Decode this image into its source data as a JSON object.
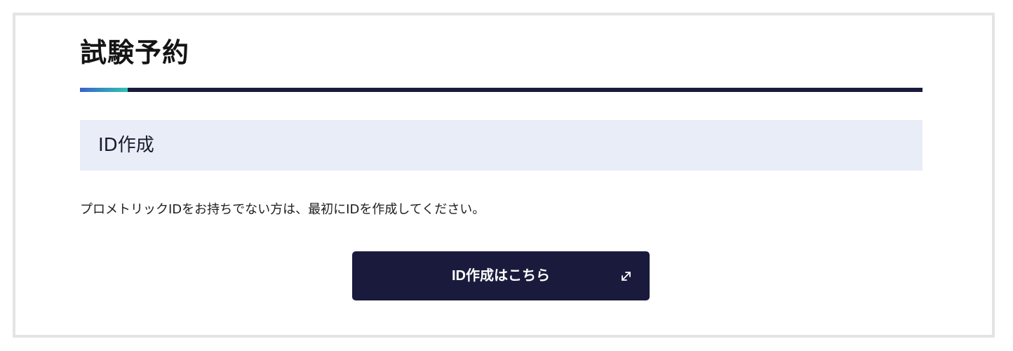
{
  "page": {
    "title": "試験予約"
  },
  "section": {
    "heading": "ID作成",
    "description": "プロメトリックIDをお持ちでない方は、最初にIDを作成してください。"
  },
  "cta": {
    "label": "ID作成はこちら",
    "icon": "external-link-icon"
  },
  "colors": {
    "primary_navy": "#1a1b3c",
    "accent_blue": "#3a63c9",
    "accent_teal": "#2fc3b3",
    "section_bg": "#e9edf8",
    "frame_border": "#e4e4e4"
  }
}
